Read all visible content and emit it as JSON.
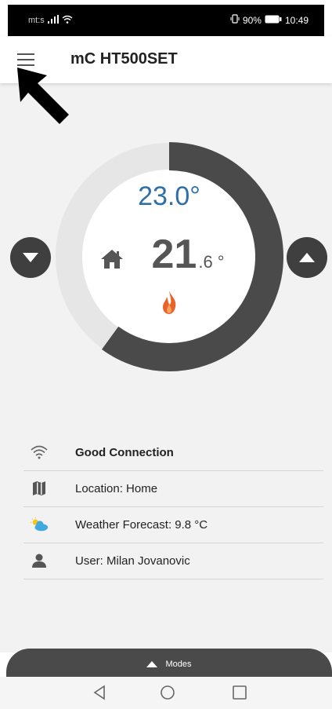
{
  "status_bar": {
    "carrier": "mt:s",
    "battery": "90%",
    "time": "10:49",
    "signal_icon": "signal-icon",
    "wifi_icon": "wifi-icon",
    "vibrate_icon": "vibrate-icon",
    "battery_icon": "battery-icon"
  },
  "app_bar": {
    "title": "mC HT500SET",
    "menu_icon": "hamburger-menu-icon"
  },
  "thermostat": {
    "setpoint": "23.0°",
    "current_int": "21",
    "current_dec": ".6",
    "current_unit": "°",
    "dial_fill_fraction": 0.6,
    "home_icon": "house-icon",
    "heating_icon": "flame-icon",
    "down_icon": "chevron-down-icon",
    "up_icon": "chevron-up-icon"
  },
  "info": {
    "connection": "Good Connection",
    "location": "Location: Home",
    "weather": "Weather Forecast: 9.8 °C",
    "user": "User: Milan Jovanovic"
  },
  "modes": {
    "label": "Modes"
  },
  "colors": {
    "dial_track": "#e6e6e6",
    "dial_fill": "#4a4a4a",
    "setpoint": "#2f6fa8",
    "flame": "#e8622a",
    "weather_cloud": "#3fa9e0",
    "weather_sun": "#f5c518"
  }
}
